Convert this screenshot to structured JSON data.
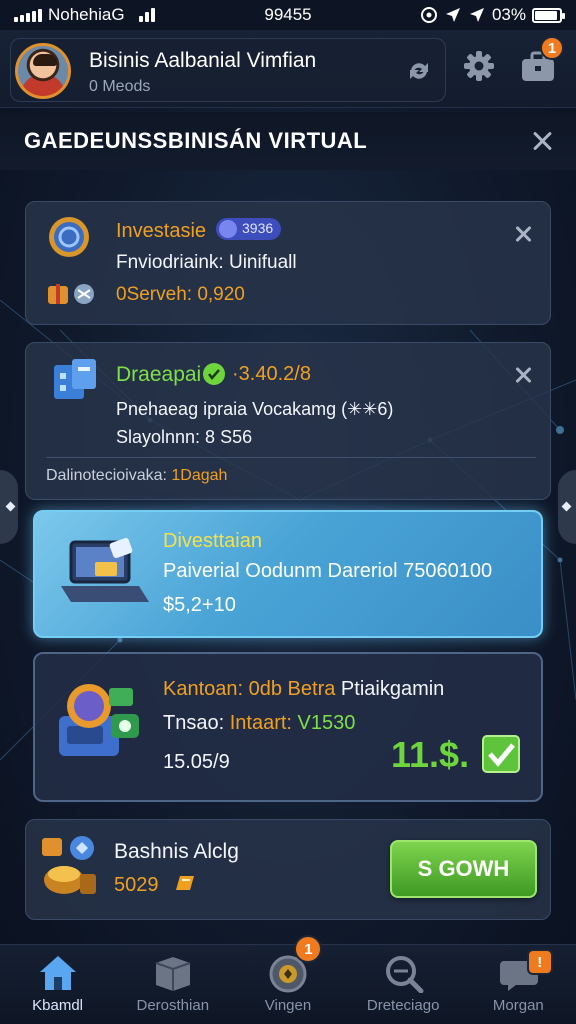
{
  "status_bar": {
    "carrier": "NohehiaG",
    "time": "99455",
    "battery": "03%"
  },
  "header": {
    "title": "Bisinis Aalbanial Vimfian",
    "subtitle": "0 Meods",
    "notification_count": "1"
  },
  "page": {
    "title": "GAEDEUNSSBINISÁN VIRTUAL"
  },
  "cards": [
    {
      "title": "Investasie",
      "badge": "3936",
      "line1": "Fnviodriaink: Uinifuall",
      "line2": "0Serveh: 0,920"
    },
    {
      "title": "Draeapai",
      "value": "·3.40.2/8",
      "line1": "Pnehaeag ipraia Vocakamg (✳✳6)",
      "line2": "Slayolnnn: 8 S56",
      "footer_label": "Dalinotecioivaka:",
      "footer_value": "1Dagah"
    },
    {
      "title": "Divesttaian",
      "line1": "Paiverial Oodunm Dareriol 75060100",
      "line2": "$5,2+10"
    },
    {
      "title_a": "Kantoan: 0db Betra",
      "title_b": "Ptiaikgamin",
      "line1_label": "Tnsao:",
      "line1_mid": "Intaart:",
      "line1_value": "V1530",
      "line2": "15.05/9",
      "profit": "11.$."
    },
    {
      "title": "Bashnis Alclg",
      "value": "5029",
      "button": "S GOWH"
    }
  ],
  "bottom_nav": [
    {
      "label": "Kbamdl",
      "icon": "home-icon",
      "active": true
    },
    {
      "label": "Derosthian",
      "icon": "box-icon",
      "active": false
    },
    {
      "label": "Vingen",
      "icon": "coin-icon",
      "active": false,
      "badge": "1"
    },
    {
      "label": "Dreteciago",
      "icon": "magnifier-icon",
      "active": false
    },
    {
      "label": "Morgan",
      "icon": "chat-icon",
      "active": false,
      "badge": "!"
    }
  ],
  "colors": {
    "accent_orange": "#f0a020",
    "accent_green": "#6ed63c",
    "highlight_blue": "#4aa4d6",
    "badge_orange": "#f07a1e"
  }
}
